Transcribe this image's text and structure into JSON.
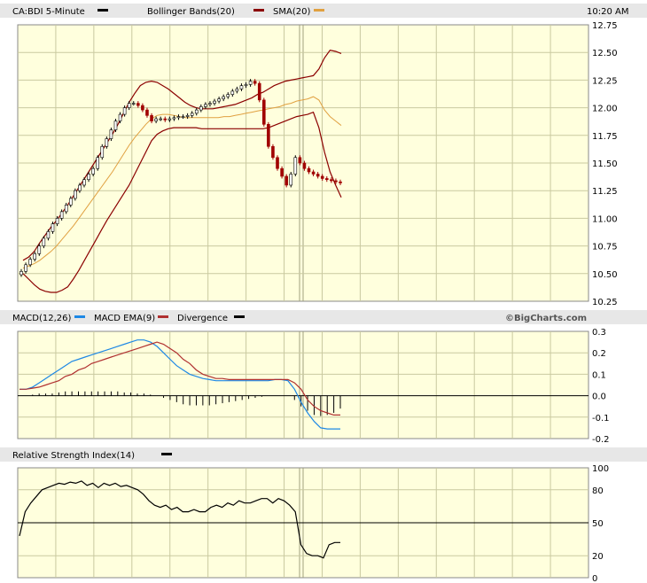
{
  "header": {
    "symbol_label": "CA:BDI 5-Minute",
    "bb_label": "Bollinger Bands(20)",
    "sma_label": "SMA(20)",
    "time_label": "10:20 AM"
  },
  "macd_header": {
    "macd_label": "MACD(12,26)",
    "ema_label": "MACD EMA(9)",
    "div_label": "Divergence",
    "copyright": "©BigCharts.com"
  },
  "rsi_header": {
    "rsi_label": "Relative Strength Index(14)"
  },
  "colors": {
    "plot_bg": "#ffffdd",
    "header_bg": "#e7e7e7",
    "grid": "#c9c9a0",
    "band": "#8b0000",
    "sma": "#e0a040",
    "macd": "#1e88e5",
    "ema": "#b03030",
    "up_candle": "#ffffff",
    "down_candle": "#a00000",
    "session_line": "#a0a080"
  },
  "chart_data": [
    {
      "type": "candlestick",
      "title": "CA:BDI 5-Minute",
      "ylim": [
        10.25,
        12.75
      ],
      "y_ticks": [
        "12.75",
        "12.50",
        "12.25",
        "12.00",
        "11.75",
        "11.50",
        "11.25",
        "11.00",
        "10.75",
        "10.50",
        "10.25"
      ],
      "x_count": 72,
      "session_break_index": 63,
      "close": [
        10.52,
        10.58,
        10.63,
        10.68,
        10.75,
        10.82,
        10.88,
        10.95,
        11.0,
        11.06,
        11.12,
        11.18,
        11.25,
        11.3,
        11.35,
        11.4,
        11.45,
        11.55,
        11.65,
        11.72,
        11.8,
        11.88,
        11.94,
        12.0,
        12.04,
        12.04,
        12.02,
        11.98,
        11.93,
        11.88,
        11.9,
        11.9,
        11.89,
        11.9,
        11.91,
        11.92,
        11.92,
        11.93,
        11.95,
        11.98,
        12.01,
        12.03,
        12.04,
        12.06,
        12.08,
        12.1,
        12.12,
        12.15,
        12.17,
        12.2,
        12.21,
        12.24,
        12.22,
        12.07,
        11.85,
        11.65,
        11.55,
        11.45,
        11.38,
        11.3,
        11.4,
        11.55,
        11.5,
        11.45,
        11.42,
        11.4,
        11.38,
        11.36,
        11.35,
        11.34,
        11.33,
        11.32
      ],
      "bollinger_upper": [
        10.62,
        10.65,
        10.7,
        10.78,
        10.85,
        10.92,
        10.98,
        11.05,
        11.12,
        11.2,
        11.28,
        11.36,
        11.44,
        11.52,
        11.6,
        11.68,
        11.76,
        11.85,
        11.95,
        12.05,
        12.13,
        12.2,
        12.23,
        12.24,
        12.23,
        12.2,
        12.17,
        12.13,
        12.09,
        12.05,
        12.02,
        12.0,
        11.99,
        11.99,
        11.99,
        12.0,
        12.01,
        12.02,
        12.03,
        12.05,
        12.07,
        12.09,
        12.12,
        12.14,
        12.17,
        12.2,
        12.22,
        12.24,
        12.25,
        12.26,
        12.27,
        12.28,
        12.29,
        12.35,
        12.45,
        12.52,
        12.51,
        12.49
      ],
      "bollinger_lower": [
        10.5,
        10.45,
        10.4,
        10.36,
        10.34,
        10.33,
        10.33,
        10.35,
        10.38,
        10.45,
        10.53,
        10.62,
        10.71,
        10.8,
        10.89,
        10.98,
        11.06,
        11.14,
        11.22,
        11.3,
        11.4,
        11.5,
        11.6,
        11.7,
        11.76,
        11.79,
        11.81,
        11.82,
        11.82,
        11.82,
        11.82,
        11.82,
        11.81,
        11.81,
        11.81,
        11.81,
        11.81,
        11.81,
        11.81,
        11.81,
        11.81,
        11.81,
        11.81,
        11.81,
        11.82,
        11.84,
        11.86,
        11.88,
        11.9,
        11.92,
        11.93,
        11.94,
        11.96,
        11.82,
        11.6,
        11.42,
        11.3,
        11.19
      ],
      "sma": [
        10.55,
        10.57,
        10.59,
        10.62,
        10.66,
        10.7,
        10.75,
        10.81,
        10.87,
        10.93,
        11.0,
        11.07,
        11.14,
        11.21,
        11.28,
        11.35,
        11.42,
        11.5,
        11.58,
        11.66,
        11.73,
        11.79,
        11.85,
        11.9,
        11.93,
        11.94,
        11.94,
        11.93,
        11.92,
        11.91,
        11.91,
        11.91,
        11.91,
        11.91,
        11.91,
        11.91,
        11.92,
        11.92,
        11.93,
        11.94,
        11.95,
        11.96,
        11.97,
        11.98,
        11.99,
        12.0,
        12.01,
        12.03,
        12.04,
        12.06,
        12.07,
        12.08,
        12.1,
        12.07,
        11.98,
        11.92,
        11.88,
        11.84
      ]
    },
    {
      "type": "line",
      "title": "MACD(12,26)",
      "ylim": [
        -0.2,
        0.3
      ],
      "y_ticks": [
        "0.3",
        "0.2",
        "0.1",
        "0.0",
        "-0.1",
        "-0.2"
      ],
      "series": [
        {
          "name": "MACD(12,26)",
          "values": [
            0.03,
            0.03,
            0.04,
            0.06,
            0.08,
            0.1,
            0.12,
            0.14,
            0.16,
            0.17,
            0.18,
            0.19,
            0.2,
            0.21,
            0.22,
            0.23,
            0.24,
            0.25,
            0.26,
            0.26,
            0.25,
            0.23,
            0.2,
            0.17,
            0.14,
            0.12,
            0.1,
            0.09,
            0.08,
            0.075,
            0.07,
            0.07,
            0.07,
            0.07,
            0.07,
            0.07,
            0.07,
            0.07,
            0.07,
            0.075,
            0.075,
            0.07,
            0.03,
            -0.03,
            -0.08,
            -0.12,
            -0.15,
            -0.155,
            -0.155,
            -0.155
          ]
        },
        {
          "name": "MACD EMA(9)",
          "values": [
            0.03,
            0.03,
            0.035,
            0.04,
            0.05,
            0.06,
            0.07,
            0.09,
            0.1,
            0.12,
            0.13,
            0.15,
            0.16,
            0.17,
            0.18,
            0.19,
            0.2,
            0.21,
            0.22,
            0.23,
            0.24,
            0.25,
            0.24,
            0.22,
            0.2,
            0.17,
            0.15,
            0.12,
            0.1,
            0.09,
            0.08,
            0.08,
            0.075,
            0.075,
            0.075,
            0.075,
            0.075,
            0.075,
            0.075,
            0.075,
            0.075,
            0.075,
            0.06,
            0.03,
            -0.02,
            -0.05,
            -0.07,
            -0.08,
            -0.09,
            -0.09
          ]
        },
        {
          "name": "Divergence",
          "values": [
            0.0,
            0.0,
            0.005,
            0.01,
            0.01,
            0.01,
            0.015,
            0.02,
            0.02,
            0.02,
            0.02,
            0.02,
            0.02,
            0.02,
            0.02,
            0.02,
            0.015,
            0.015,
            0.01,
            0.01,
            0.005,
            0.0,
            -0.01,
            -0.02,
            -0.03,
            -0.04,
            -0.045,
            -0.045,
            -0.045,
            -0.045,
            -0.04,
            -0.035,
            -0.03,
            -0.025,
            -0.02,
            -0.015,
            -0.01,
            -0.005,
            0.0,
            0.0,
            0.0,
            0.0,
            -0.02,
            -0.05,
            -0.07,
            -0.09,
            -0.095,
            -0.09,
            -0.08,
            -0.06
          ]
        }
      ]
    },
    {
      "type": "line",
      "title": "Relative Strength Index(14)",
      "ylim": [
        0,
        100
      ],
      "y_ticks": [
        "100",
        "80",
        "50",
        "20",
        "0"
      ],
      "reference_line": 50,
      "series": [
        {
          "name": "Relative Strength Index(14)",
          "values": [
            38,
            60,
            68,
            74,
            80,
            82,
            84,
            86,
            85,
            87,
            86,
            88,
            84,
            86,
            82,
            86,
            84,
            86,
            83,
            84,
            82,
            80,
            76,
            70,
            66,
            64,
            66,
            62,
            64,
            60,
            60,
            62,
            60,
            60,
            64,
            66,
            64,
            68,
            66,
            70,
            68,
            68,
            70,
            72,
            72,
            68,
            72,
            70,
            66,
            60,
            30,
            22,
            20,
            20,
            18,
            30,
            32,
            32
          ]
        }
      ]
    }
  ]
}
